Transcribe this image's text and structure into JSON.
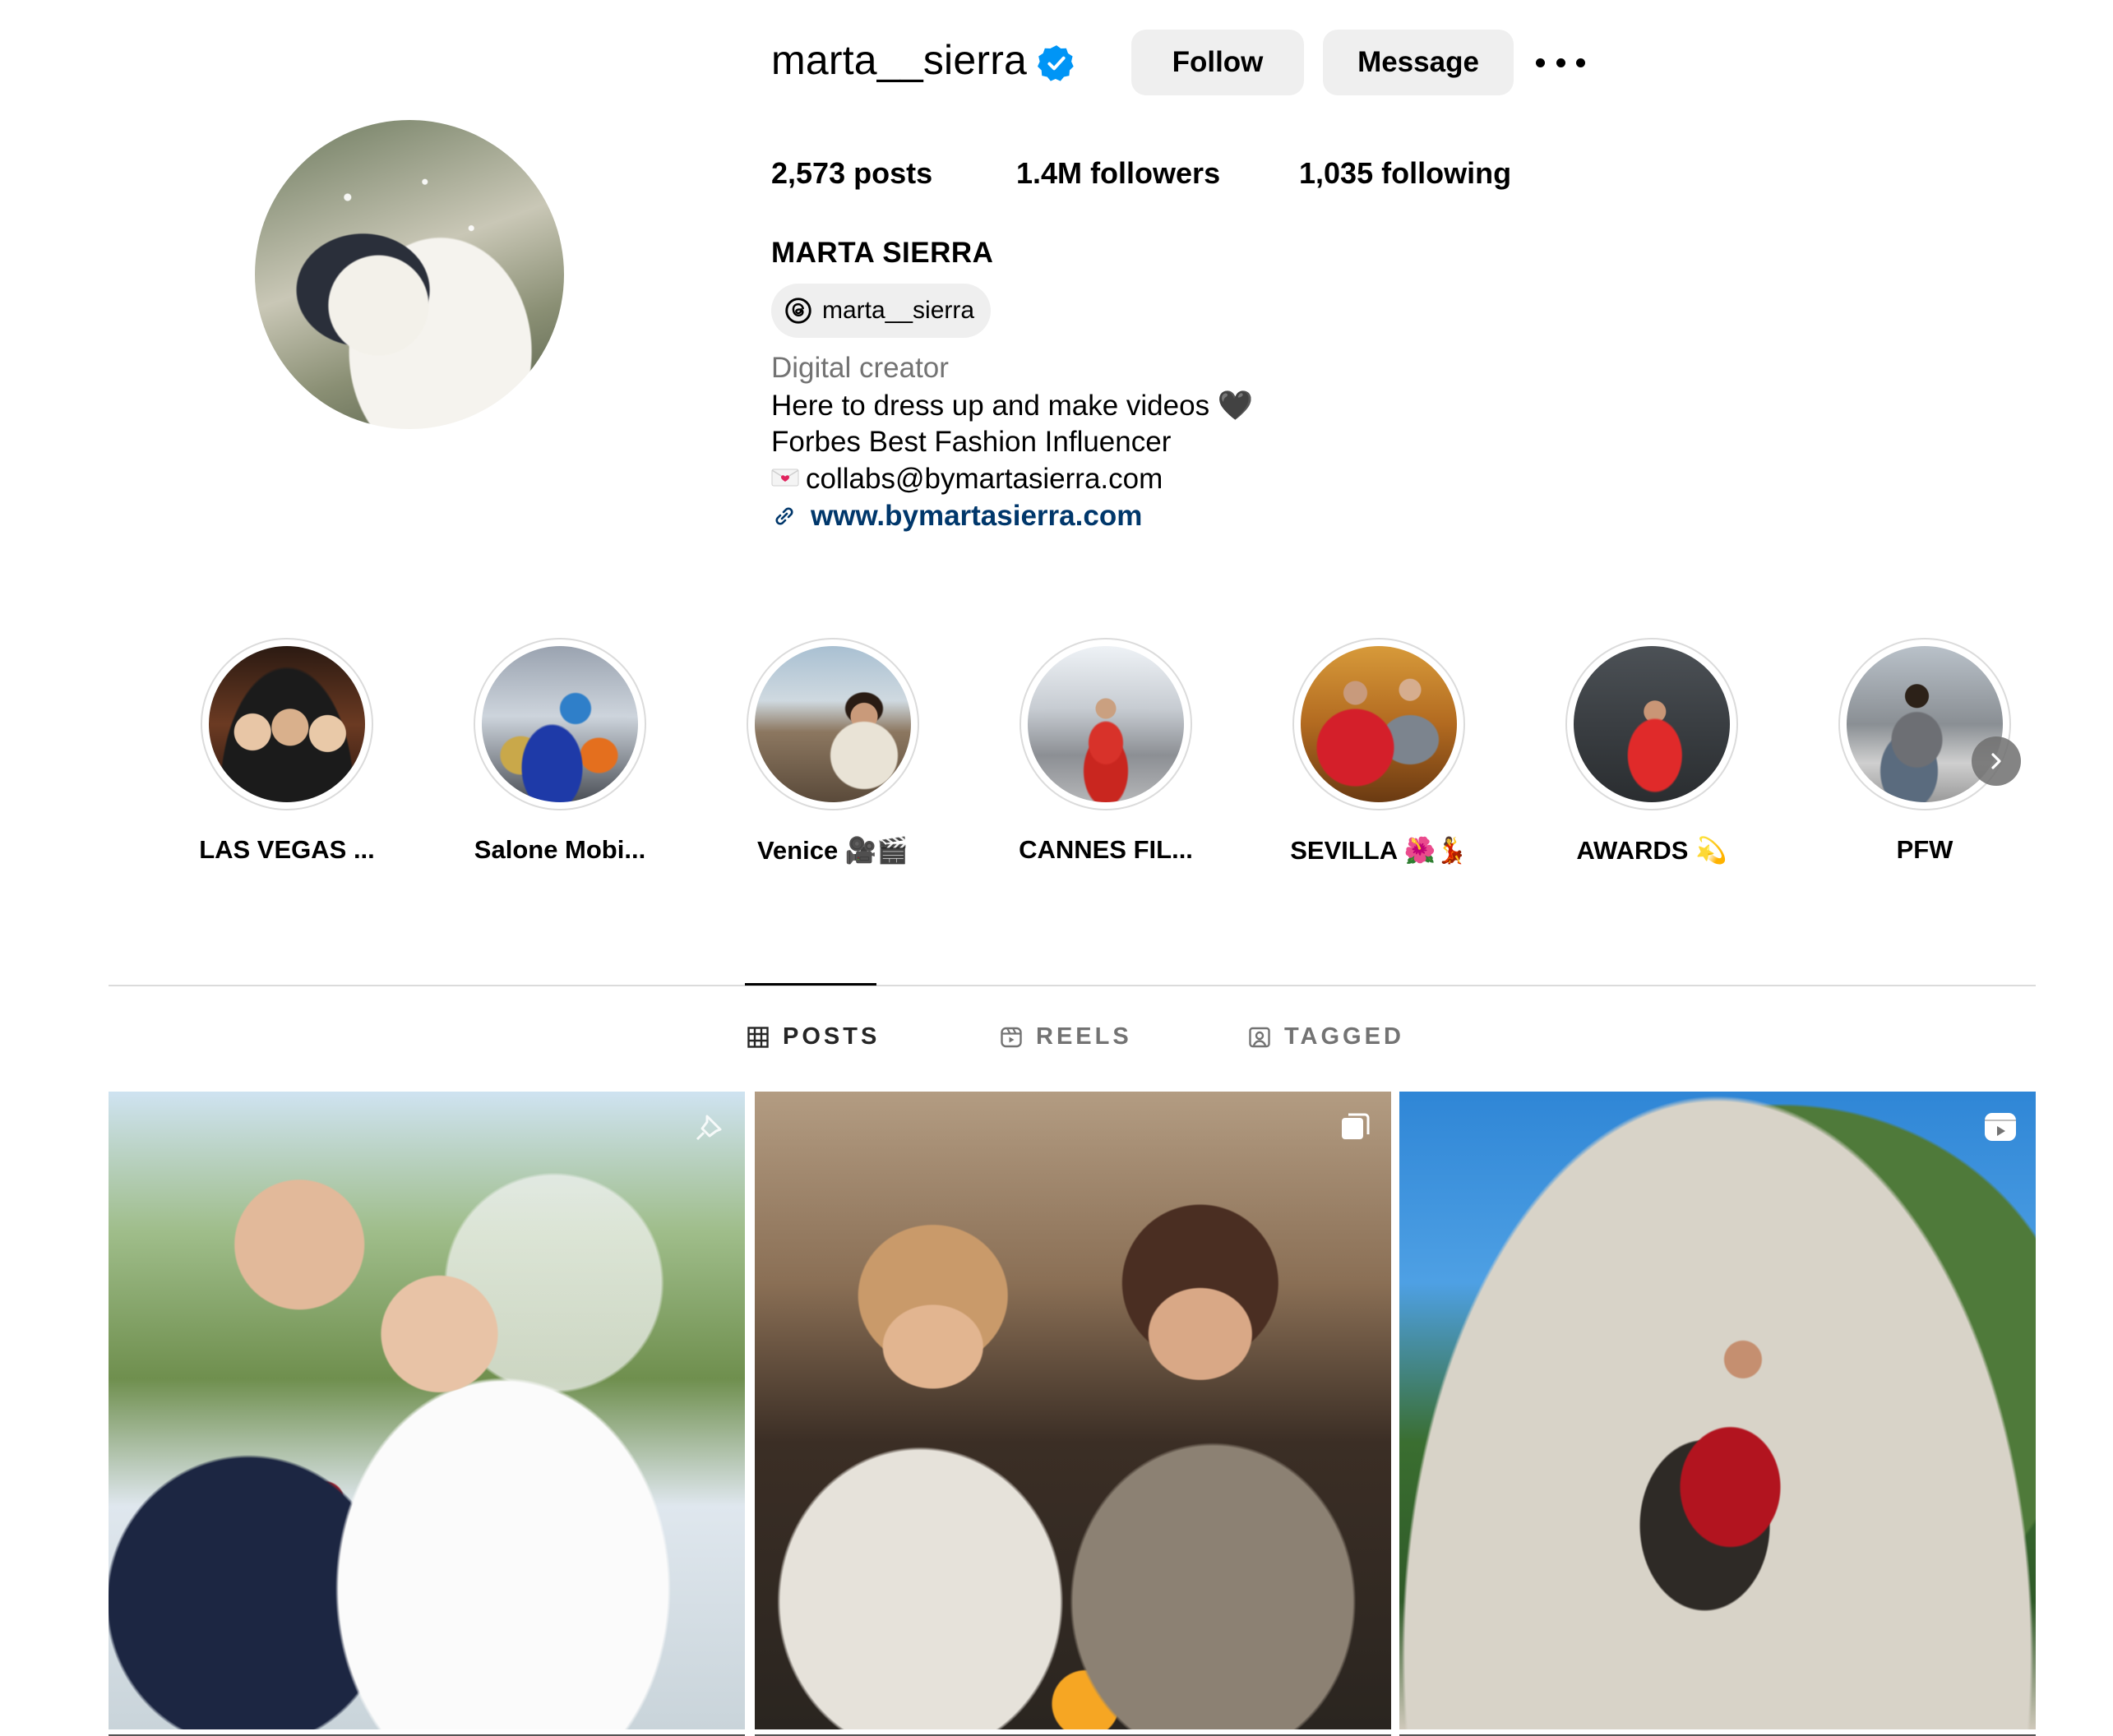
{
  "profile": {
    "username": "marta__sierra",
    "verified": true,
    "follow_label": "Follow",
    "message_label": "Message",
    "stats": {
      "posts_value": "2,573",
      "posts_label": "posts",
      "followers_value": "1.4M",
      "followers_label": "followers",
      "following_value": "1,035",
      "following_label": "following"
    },
    "full_name": "MARTA SIERRA",
    "threads_handle": "marta__sierra",
    "bio": {
      "category": "Digital creator",
      "line1": "Here to dress up and make videos 🖤",
      "line2": "Forbes Best Fashion Influencer",
      "line3": "collabs@bymartasierra.com",
      "link": "www.bymartasierra.com"
    }
  },
  "highlights": [
    {
      "label": "LAS VEGAS ..."
    },
    {
      "label": "Salone Mobi..."
    },
    {
      "label": "Venice 🎥🎬"
    },
    {
      "label": "CANNES FIL..."
    },
    {
      "label": "SEVILLA 🌺💃"
    },
    {
      "label": "AWARDS 💫"
    },
    {
      "label": "PFW"
    }
  ],
  "tabs": [
    {
      "label": "POSTS",
      "active": true,
      "icon": "grid-icon"
    },
    {
      "label": "REELS",
      "active": false,
      "icon": "reels-icon"
    },
    {
      "label": "TAGGED",
      "active": false,
      "icon": "tagged-icon"
    }
  ],
  "posts": [
    {
      "type": "pinned",
      "icon": "pin-icon"
    },
    {
      "type": "carousel",
      "icon": "carousel-icon"
    },
    {
      "type": "reel",
      "icon": "reel-icon"
    }
  ],
  "colors": {
    "verified_blue": "#0095f6",
    "link_blue": "#00376b",
    "button_bg": "#efefef",
    "muted_text": "#737373",
    "divider": "#dbdbdb"
  }
}
